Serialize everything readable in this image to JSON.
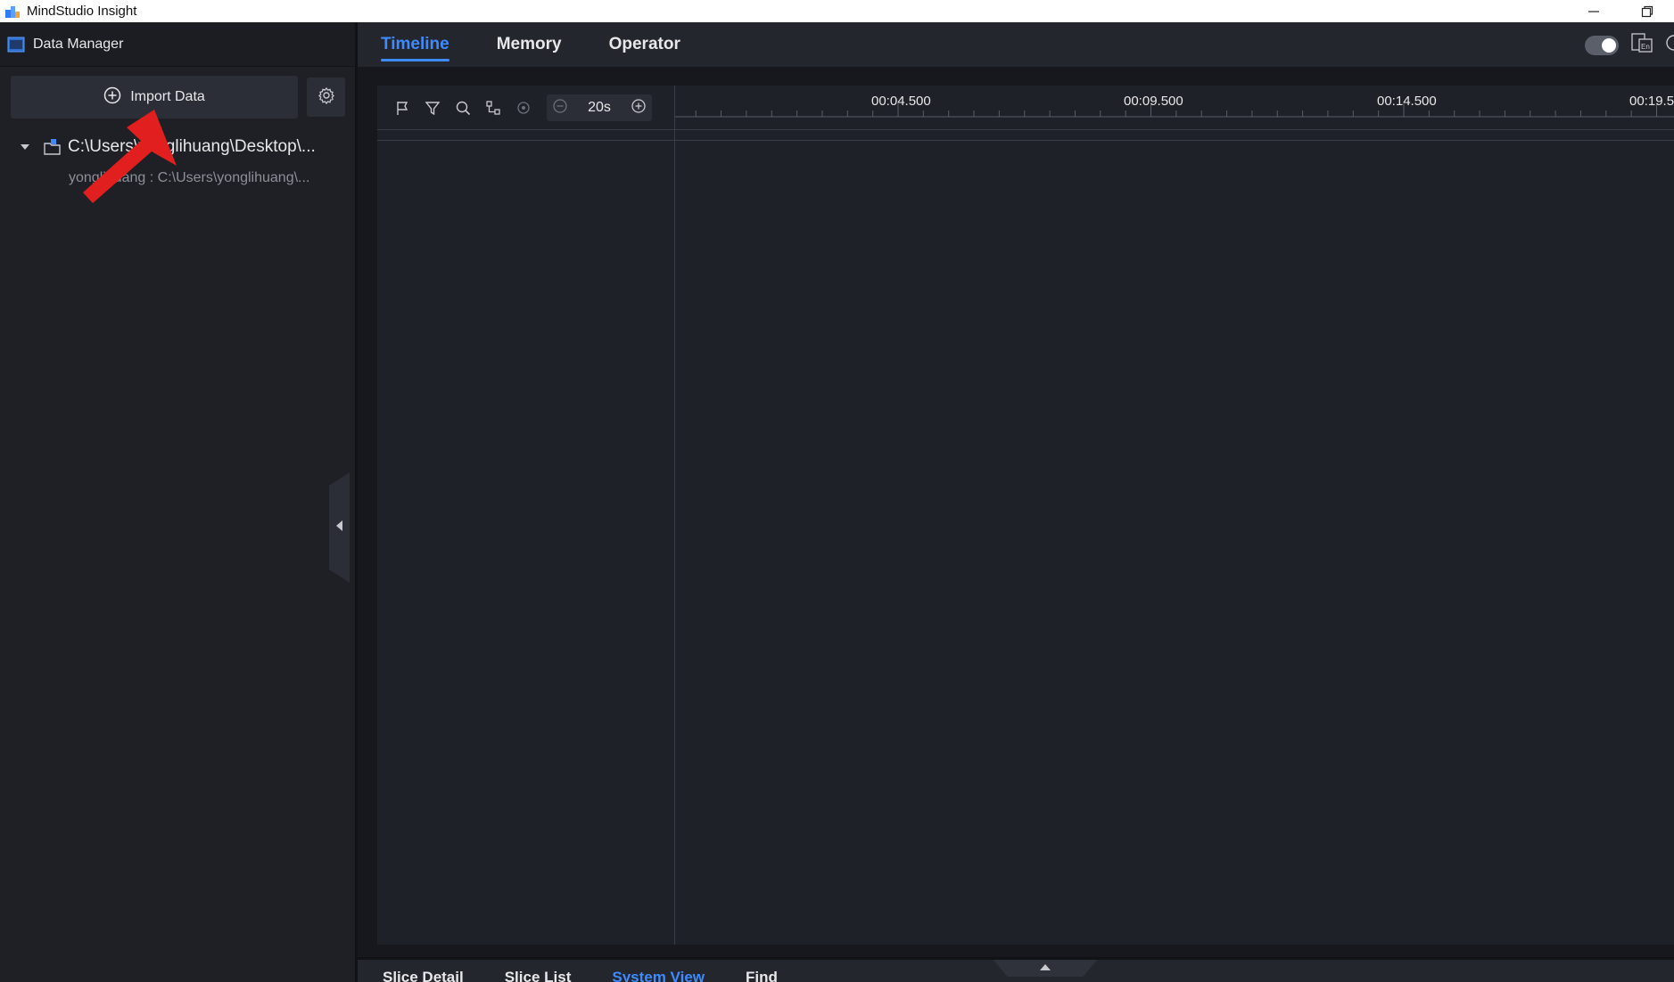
{
  "window": {
    "title": "MindStudio Insight",
    "controls": [
      "minimize-icon",
      "restore-icon"
    ]
  },
  "sidebar": {
    "header": "Data Manager",
    "import_label": "Import Data",
    "tree": {
      "root_path": "C:\\Users\\yonglihuang\\Desktop\\...",
      "sub_item": "yonglihuang : C:\\Users\\yonglihuang\\..."
    }
  },
  "tabs": [
    {
      "label": "Timeline",
      "active": true
    },
    {
      "label": "Memory",
      "active": false
    },
    {
      "label": "Operator",
      "active": false
    }
  ],
  "timeline": {
    "zoom_value": "20s",
    "ruler_labels": [
      "00:04.500",
      "00:09.500",
      "00:14.500",
      "00:19.5"
    ]
  },
  "bottom_tabs": [
    {
      "label": "Slice Detail",
      "active": false
    },
    {
      "label": "Slice List",
      "active": false
    },
    {
      "label": "System View",
      "active": true
    },
    {
      "label": "Find",
      "active": false
    }
  ],
  "colors": {
    "accent": "#3d8bff",
    "annotation_arrow": "#e21f1f",
    "background": "#1f2128"
  },
  "icons": [
    "flag-icon",
    "filter-icon",
    "search-icon",
    "link-icon",
    "reset-icon",
    "zoom-out-icon",
    "zoom-in-icon",
    "gear-icon",
    "folder-icon",
    "caret-down-icon",
    "collapse-left-icon",
    "theme-toggle",
    "language-icon"
  ]
}
